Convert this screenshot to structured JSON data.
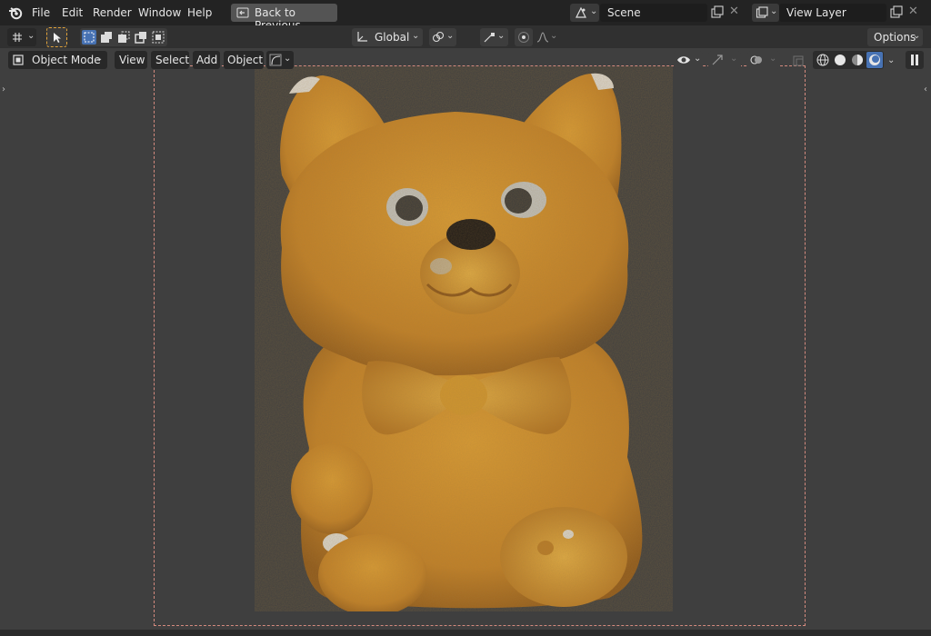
{
  "menu": {
    "items": [
      "File",
      "Edit",
      "Render",
      "Window",
      "Help"
    ]
  },
  "back_to_previous": {
    "label": "Back to Previous"
  },
  "scene": {
    "label": "Scene"
  },
  "view_layer": {
    "label": "View Layer"
  },
  "toolbar": {
    "transform_orientation": "Global",
    "options_label": "Options"
  },
  "viewport_header": {
    "mode": "Object Mode",
    "menus": [
      "View",
      "Select",
      "Add",
      "Object"
    ]
  },
  "colors": {
    "topbar_bg": "#232323",
    "toolrow_bg": "#303030",
    "viewport_bg": "#3f3f3f",
    "active_blue": "#4772b3",
    "frame_dash": "#d48a7e",
    "select_orange": "#e0a23a"
  },
  "icons": {
    "app_logo": "blender-logo-icon",
    "scene_selector": "scene-icon",
    "view_layer_selector": "view-layer-icon",
    "back": "back-arrow-icon",
    "shading_modes": [
      "wireframe-shading-icon",
      "solid-shading-icon",
      "material-shading-icon",
      "rendered-shading-icon"
    ]
  }
}
